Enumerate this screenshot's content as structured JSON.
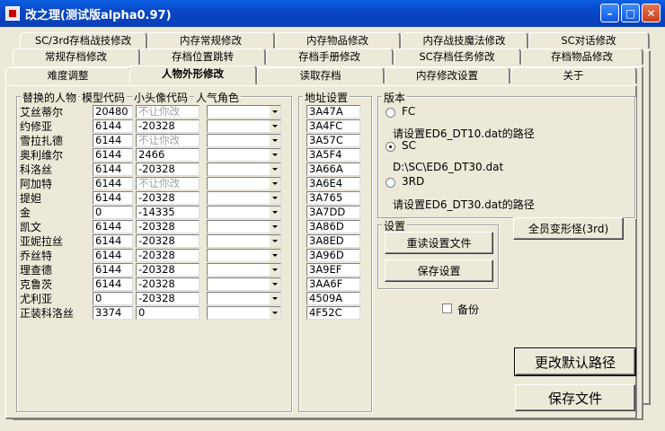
{
  "window": {
    "title": "改之理(测试版alpha0.97)"
  },
  "tabs_row1": [
    "SC/3rd存档战技修改",
    "内存常规修改",
    "内存物品修改",
    "内存战技魔法修改",
    "SC对话修改"
  ],
  "tabs_row2": [
    "常规存档修改",
    "存档位置跳转",
    "存档手册修改",
    "SC存档任务修改",
    "存档物品修改"
  ],
  "tabs_row3": [
    "难度调整",
    "人物外形修改",
    "读取存档",
    "内存修改设置",
    "关于"
  ],
  "characters": {
    "title": "替换的人物",
    "col_model": "模型代码",
    "col_avatar": "小头像代码",
    "col_role": "人气角色",
    "rows": [
      {
        "name": "艾丝蒂尔",
        "model": "20480",
        "avatar": "不让你改",
        "avatar_disabled": true
      },
      {
        "name": "约修亚",
        "model": "6144",
        "avatar": "-20328",
        "avatar_disabled": false
      },
      {
        "name": "雪拉扎德",
        "model": "6144",
        "avatar": "不让你改",
        "avatar_disabled": true
      },
      {
        "name": "奥利维尔",
        "model": "6144",
        "avatar": "2466",
        "avatar_disabled": false
      },
      {
        "name": "科洛丝",
        "model": "6144",
        "avatar": "-20328",
        "avatar_disabled": false
      },
      {
        "name": "阿加特",
        "model": "6144",
        "avatar": "不让你改",
        "avatar_disabled": true
      },
      {
        "name": "提妲",
        "model": "6144",
        "avatar": "-20328",
        "avatar_disabled": false
      },
      {
        "name": "金",
        "model": "0",
        "avatar": "-14335",
        "avatar_disabled": false
      },
      {
        "name": "凯文",
        "model": "6144",
        "avatar": "-20328",
        "avatar_disabled": false
      },
      {
        "name": "亚妮拉丝",
        "model": "6144",
        "avatar": "-20328",
        "avatar_disabled": false
      },
      {
        "name": "乔丝特",
        "model": "6144",
        "avatar": "-20328",
        "avatar_disabled": false
      },
      {
        "name": "理查德",
        "model": "6144",
        "avatar": "-20328",
        "avatar_disabled": false
      },
      {
        "name": "克鲁茨",
        "model": "6144",
        "avatar": "-20328",
        "avatar_disabled": false
      },
      {
        "name": "尤利亚",
        "model": "0",
        "avatar": "-20328",
        "avatar_disabled": false
      },
      {
        "name": "正装科洛丝",
        "model": "3374",
        "avatar": "0",
        "avatar_disabled": false
      }
    ]
  },
  "addresses": {
    "title": "地址设置",
    "values": [
      "3A47A",
      "3A4FC",
      "3A57C",
      "3A5F4",
      "3A66A",
      "3A6E4",
      "3A765",
      "3A7DD",
      "3A86D",
      "3A8ED",
      "3A96D",
      "3A9EF",
      "3AA6F",
      "4509A",
      "4F52C"
    ]
  },
  "version": {
    "title": "版本",
    "fc_label": "FC",
    "fc_path": "请设置ED6_DT10.dat的路径",
    "sc_label": "SC",
    "sc_path": "D:\\SC\\ED6_DT30.dat",
    "rd_label": "3RD",
    "rd_path": "请设置ED6_DT30.dat的路径",
    "selected": "SC"
  },
  "settings": {
    "title": "设置",
    "reload_label": "重读设置文件",
    "save_settings_label": "保存设置"
  },
  "actions": {
    "all_transform_label": "全员变形怪(3rd)",
    "backup_label": "备份",
    "change_path_label": "更改默认路径",
    "save_file_label": "保存文件"
  }
}
